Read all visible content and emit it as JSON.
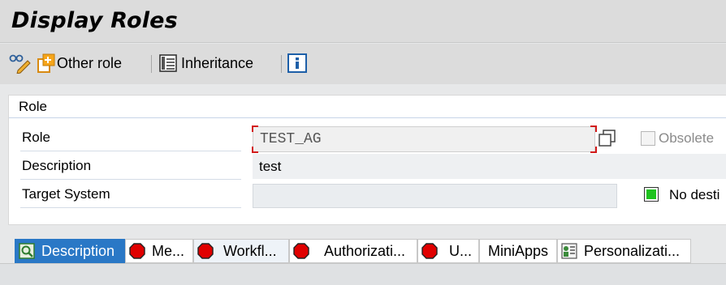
{
  "header": {
    "title": "Display Roles"
  },
  "toolbar": {
    "other_role_label": "Other role",
    "inheritance_label": "Inheritance"
  },
  "role_panel": {
    "title": "Role",
    "role_label": "Role",
    "role_value": "TEST_AG",
    "obsolete_label": "Obsolete",
    "obsolete_checked": false,
    "description_label": "Description",
    "description_value": "test",
    "target_system_label": "Target System",
    "target_system_value": "",
    "status_text": "No desti",
    "status_color": "#1fc31f"
  },
  "tabs": [
    {
      "label": "Description",
      "icon": "description-icon",
      "active": true
    },
    {
      "label": "Me...",
      "icon": "red-light-icon",
      "active": false
    },
    {
      "label": "Workfl...",
      "icon": "red-light-icon",
      "active": false
    },
    {
      "label": "Authorizati...",
      "icon": "red-light-icon",
      "active": false
    },
    {
      "label": "U...",
      "icon": "red-light-icon",
      "active": false
    },
    {
      "label": "MiniApps",
      "icon": "",
      "active": false
    },
    {
      "label": "Personalizati...",
      "icon": "personalization-icon",
      "active": false
    }
  ],
  "colors": {
    "accent": "#2a78c6",
    "error": "#e00000",
    "ok": "#1fc31f"
  }
}
